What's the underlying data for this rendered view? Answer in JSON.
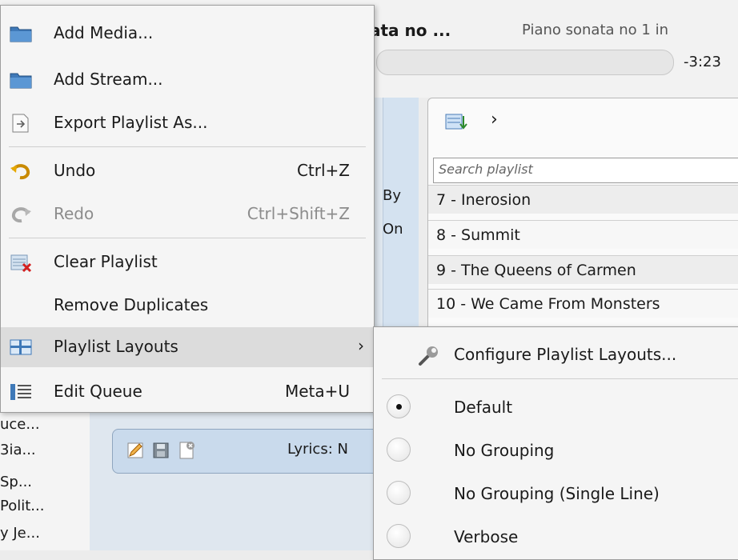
{
  "header": {
    "track_title": "ata no ...",
    "track_album": "Piano sonata no 1 in",
    "time_remaining": "-3:23"
  },
  "left_strip": [
    "uce...",
    "3ia...",
    "Sp...",
    "Polit...",
    "y Je..."
  ],
  "info_fragments": [
    "By",
    "On"
  ],
  "lyrics_toolbar": {
    "label": "Lyrics: N"
  },
  "playlist": {
    "search_placeholder": "Search playlist",
    "rows": [
      "7 - Inerosion",
      "8 - Summit",
      "9 - The Queens of Carmen",
      "10 - We Came From Monsters"
    ]
  },
  "menu": {
    "add_media": "Add Media...",
    "add_stream": "Add Stream...",
    "export_playlist": "Export Playlist As...",
    "undo": "Undo",
    "undo_shortcut": "Ctrl+Z",
    "redo": "Redo",
    "redo_shortcut": "Ctrl+Shift+Z",
    "clear_playlist": "Clear Playlist",
    "remove_duplicates": "Remove Duplicates",
    "playlist_layouts": "Playlist Layouts",
    "edit_queue": "Edit Queue",
    "edit_queue_shortcut": "Meta+U"
  },
  "submenu": {
    "configure": "Configure Playlist Layouts...",
    "selected": "Default",
    "layouts": [
      "Default",
      "No Grouping",
      "No Grouping (Single Line)",
      "Verbose"
    ]
  },
  "icons": {
    "folder": "folder-icon",
    "export": "export-icon",
    "undo": "undo-icon",
    "redo": "redo-icon",
    "clear": "clear-playlist-icon",
    "layouts": "layout-icon",
    "queue": "queue-icon",
    "wrench": "wrench-icon",
    "chevron": "chevron-right-icon"
  }
}
